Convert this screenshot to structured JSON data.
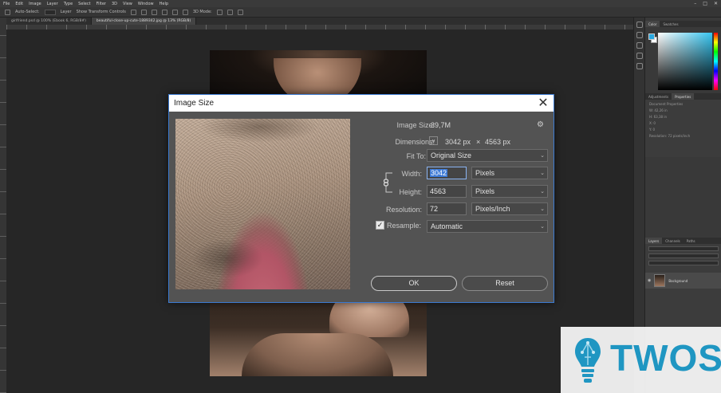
{
  "app": {
    "menu": [
      "File",
      "Edit",
      "Image",
      "Layer",
      "Type",
      "Select",
      "Filter",
      "3D",
      "View",
      "Window",
      "Help"
    ],
    "window_controls": [
      "–",
      "□",
      "✕"
    ],
    "options": [
      "Auto-Select:",
      "Layer",
      "Show Transform Controls",
      "3D Mode:"
    ],
    "tabs": [
      "girlfriend.psd @ 100% (Ebook 6, RGB/8#)",
      "beautiful-close-up-cute-1889342.jpg @ 13% (RGB/8)"
    ]
  },
  "panels": {
    "color_tabs": [
      "Color",
      "Swatches"
    ],
    "props_tabs": [
      "Adjustments",
      "Properties"
    ],
    "props_title": "Document Properties",
    "props_lines": [
      "W: 42,26 in",
      "H: 63,38 in",
      "X: 0",
      "Y: 0",
      "Resolution: 72 pixels/inch"
    ],
    "layers_tabs": [
      "Layers",
      "Channels",
      "Paths"
    ],
    "layer_name": "Background",
    "color_fg": "#2aa8e0",
    "color_bg": "#ffffff"
  },
  "dialog": {
    "title": "Image Size",
    "close": "✕",
    "image_size_label": "Image Size:",
    "image_size_value": "39,7M",
    "gear": "⚙",
    "dimensions_label": "Dimensions:",
    "dimensions_chevron": "∨",
    "dimensions_width": "3042 px",
    "dimensions_x": "×",
    "dimensions_height": "4563 px",
    "fit_to_label": "Fit To:",
    "fit_to_value": "Original Size",
    "width_label": "Width:",
    "width_value": "3042",
    "width_unit": "Pixels",
    "height_label": "Height:",
    "height_value": "4563",
    "height_unit": "Pixels",
    "resolution_label": "Resolution:",
    "resolution_value": "72",
    "resolution_unit": "Pixels/Inch",
    "resample_label": "Resample:",
    "resample_checked": "✓",
    "resample_value": "Automatic",
    "chevron": "⌄",
    "ok_label": "OK",
    "reset_label": "Reset"
  },
  "watermark": {
    "text": "TWOS",
    "color": "#1f96c2"
  }
}
